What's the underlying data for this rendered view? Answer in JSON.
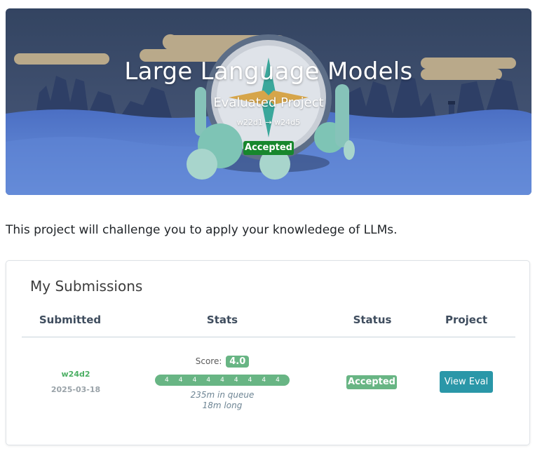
{
  "project": {
    "title": "Large Language Models",
    "subtitle": "Evaluated Project",
    "weeks": "w22d1 → w24d5",
    "status": "Accepted",
    "description": "This project will challenge you to apply your knowledege of LLMs."
  },
  "submissions": {
    "title": "My Submissions",
    "headers": {
      "submitted": "Submitted",
      "stats": "Stats",
      "status": "Status",
      "project": "Project"
    },
    "rows": [
      {
        "week": "w24d2",
        "date": "2025-03-18",
        "score_label": "Score:",
        "score": "4.0",
        "test_scores": [
          "4",
          "4",
          "4",
          "4",
          "4",
          "4",
          "4",
          "4",
          "4"
        ],
        "queue_time": "235m in queue",
        "duration": "18m long",
        "status": "Accepted",
        "action": "View Eval"
      }
    ]
  },
  "colors": {
    "accepted_dark": "#17872d",
    "accepted_light": "#68b584",
    "button": "#2a97a8",
    "sky": "#3e4d6a",
    "water": "#4c72c6"
  },
  "icons": [
    "compass-illustration",
    "lighthouse-icon",
    "tree-icon"
  ]
}
